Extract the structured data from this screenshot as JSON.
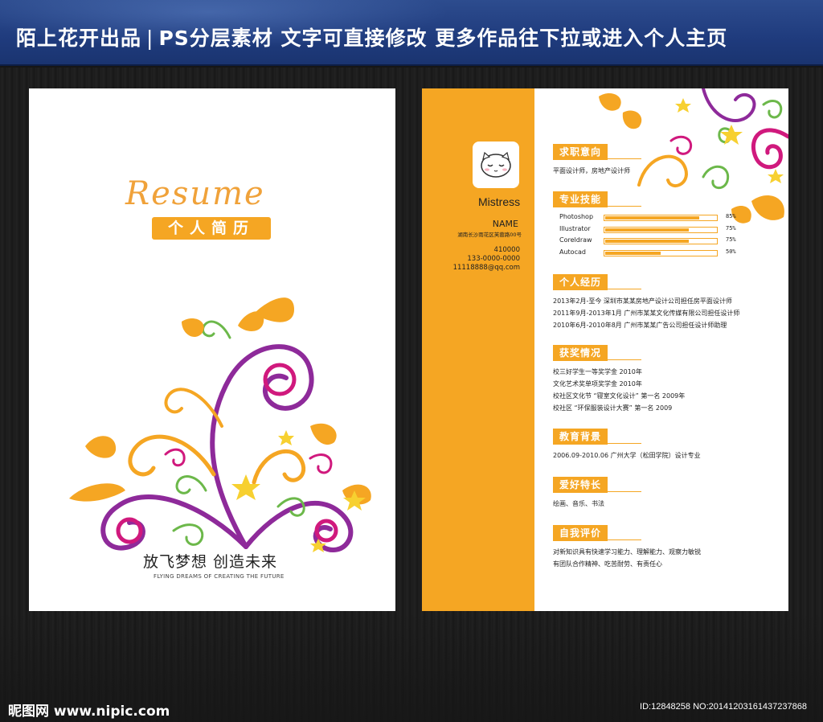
{
  "banner": {
    "part1": "陌上花开出品",
    "separator": "|",
    "part2": "PS分层素材  文字可直接修改  更多作品往下拉或进入个人主页"
  },
  "cover": {
    "script_title": "Resume",
    "badge": "个人简历",
    "slogan": "放飞梦想   创造未来",
    "slogan_en": "FLYING DREAMS OF CREATING THE FUTURE"
  },
  "sidebar": {
    "name_en": "Mistress",
    "name_label": "NAME",
    "address": "湖南长沙雨花区芙蓉路00号",
    "zip": "410000",
    "phone": "133-0000-0000",
    "email": "11118888@qq.com"
  },
  "sections": {
    "intent": {
      "title": "求职意向",
      "lines": [
        "平面设计师，房地产设计师"
      ]
    },
    "skills": {
      "title": "专业技能",
      "items": [
        {
          "name": "Photoshop",
          "pct_label": "85%",
          "level": 0.85
        },
        {
          "name": "Illustrator",
          "pct_label": "75%",
          "level": 0.75
        },
        {
          "name": "Coreldraw",
          "pct_label": "75%",
          "level": 0.75
        },
        {
          "name": "Autocad",
          "pct_label": "50%",
          "level": 0.5
        }
      ]
    },
    "experience": {
      "title": "个人经历",
      "lines": [
        "2013年2月-至今  深圳市某某房地产设计公司担任房平面设计师",
        "2011年9月-2013年1月  广州市某某文化传媒有限公司担任设计师",
        "2010年6月-2010年8月  广州市某某广告公司担任设计师助理"
      ]
    },
    "awards": {
      "title": "获奖情况",
      "lines": [
        "校三好学生一等奖学金  2010年",
        "文化艺术奖单项奖学金  2010年",
        "校社区文化节 “寝室文化设计” 第一名 2009年",
        "校社区 “环保服装设计大赛” 第一名 2009"
      ]
    },
    "education": {
      "title": "教育背景",
      "lines": [
        "2006.09-2010.06 广州大学（松田学院）设计专业"
      ]
    },
    "hobbies": {
      "title": "爱好特长",
      "lines": [
        "绘画、音乐、书法"
      ]
    },
    "self": {
      "title": "自我评价",
      "lines": [
        "对新知识具有快速学习能力、理解能力、观察力敏锐",
        "有团队合作精神、吃苦耐劳、有责任心"
      ]
    }
  },
  "watermark": {
    "left": "昵图网 www.nipic.com",
    "right": "ID:12848258 NO:20141203161437237868"
  },
  "colors": {
    "accent": "#f5a623",
    "purple": "#8e2a9a",
    "magenta": "#d0197d",
    "green": "#6cb84a",
    "yellow": "#f7d030",
    "banner": "#1f3b7d"
  }
}
